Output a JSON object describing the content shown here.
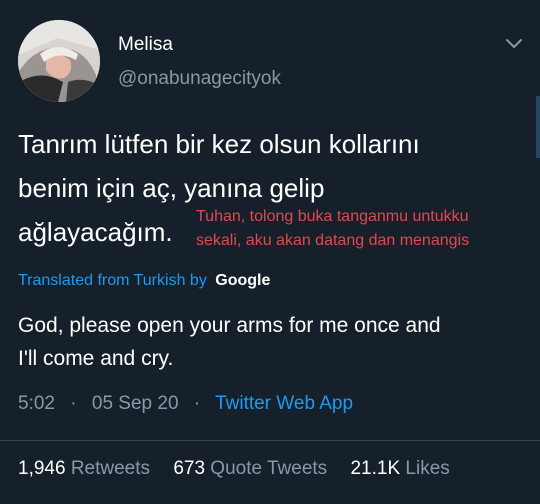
{
  "user": {
    "display_name": "Melisa",
    "handle": "@onabunagecityok"
  },
  "tweet": {
    "lines": [
      "Tanrım lütfen bir kez olsun kollarını",
      "benim için aç, yanına gelip",
      "ağlayacağım."
    ]
  },
  "overlay": {
    "lines": [
      "Tuhan, tolong buka tanganmu untukku",
      "sekali, aku akan datang dan menangis"
    ]
  },
  "translation": {
    "label": "Translated from Turkish",
    "by": "by",
    "provider": "Google",
    "lines": [
      "God, please open your arms for me once and",
      "I'll come and cry."
    ]
  },
  "meta": {
    "time": "5:02",
    "date": "05 Sep 20",
    "separator": "·",
    "app": "Twitter Web App"
  },
  "stats": [
    {
      "count": "1,946",
      "label": "Retweets"
    },
    {
      "count": "673",
      "label": "Quote Tweets"
    },
    {
      "count": "21.1K",
      "label": "Likes"
    }
  ],
  "colors": {
    "background": "#15202b",
    "link": "#1d9bf0",
    "secondary_text": "#8899a6",
    "overlay_text": "#e0494f"
  },
  "icons": {
    "avatar": "avatar-photo",
    "menu": "chevron-down-icon"
  }
}
